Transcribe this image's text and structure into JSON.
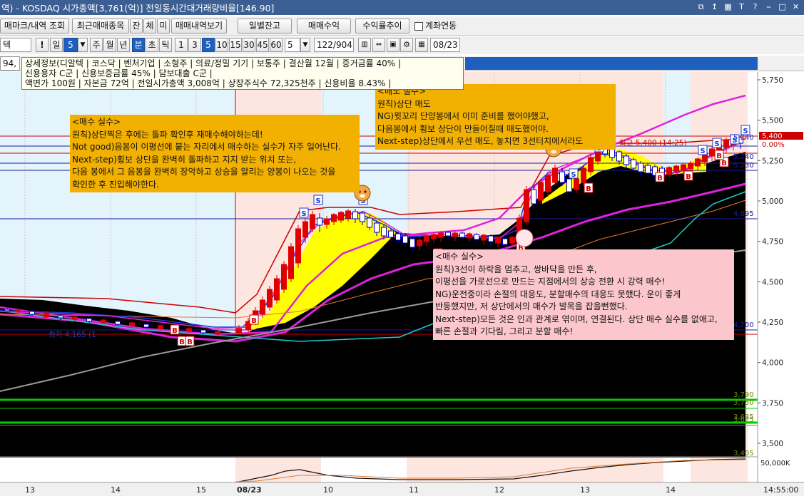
{
  "window": {
    "title": "역) - KOSDAQ 시가총액[3,761(억)] 전일동시간대거래량비율[146.90]",
    "buttons": [
      "⧉",
      "↥",
      "▦",
      "T",
      "?",
      "⎯",
      "□",
      "✕"
    ]
  },
  "row2": {
    "buttons": [
      "매마크/내역 조회",
      "최근매매종목",
      "잔",
      "체",
      "미",
      "매매내역보기",
      "일별잔고",
      "매매수익",
      "수익률추이"
    ],
    "checkbox_label": "계좌연동"
  },
  "toolbar": {
    "symbol_input": "텍",
    "excl": "!",
    "period_label": "일",
    "period_value": "5",
    "periods": [
      "주",
      "월",
      "년",
      "분",
      "초",
      "틱"
    ],
    "minutes": [
      "1",
      "3",
      "5",
      "10",
      "15",
      "30",
      "45",
      "60"
    ],
    "count_value": "5",
    "range": "122/904",
    "date": "08/23"
  },
  "row4": {
    "code": "94,"
  },
  "info": {
    "line1": "상세정보(디알텍 | 코스닥 | 벤처기업 | 소형주 | 의료/정밀 기기 | 보통주 | 결산월 12월 | 증거금률 40% |",
    "line2": "신용용자 C군 | 신용보증금률 45% | 담보대출 C군 |",
    "line3": "액면가 100원 | 자본금 72억 | 전일시가총액 3,008억 | 상장주식수 72,325천주 | 신용비율 8.43% |"
  },
  "notes": {
    "buy1": {
      "title": "<매수 실수>",
      "lines": [
        "원칙)상단찍은 후에는 돌파 확인후 재매수해야하는데!",
        "Not good)음봉이 이평선에 붙는 자리에서 매수하는 실수가 자주 일어난다.",
        "Next-step)횡보 상단을 완벽히 돌파하고 지지 받는 위치 또는,",
        "다음 봉에서 그 음봉을 완벽히 장악하고 상승을 알리는 양봉이 나오는 것을",
        "확인한 후 진입해야한다."
      ]
    },
    "sell": {
      "title": "<매도 실수>",
      "lines": [
        "원칙)상단 매도",
        "NG)윗꼬리 단양봉에서 이미 준비를 했어야했고,",
        "다음봉에서 횡보 상단이 만들어질때 매도했어야.",
        "Next-step)상단에서 우선 매도, 놓치면 3선터치에서라도"
      ]
    },
    "buy2": {
      "title": "<매수 실수>",
      "lines": [
        "원칙)3선이 하락을 멈추고, 쌍바닥을 만든 후,",
        "이평선을 가로선으로 만드는 지점에서의 상승 전환 시 강력 매수!",
        "NG)운전중이라 손절의 대응도, 분할매수의 대응도 못했다. 운이 좋게",
        "반등했지만, 저 상단에서의 매수가 발목을 잡을뻔했다.",
        "Next-step)모든 것은 인과 관계로 엮이며, 연결된다. 상단 매수 실수를 없애고,",
        "빠른 손절과 기다림, 그리고 분할 매수!"
      ]
    }
  },
  "chart_labels": {
    "high": "최고 5,400 (14:25)",
    "low": "최저 4,165 (1",
    "price_tag": "5,400",
    "pct_tag": "0.00%",
    "p5240": "5,240",
    "p5230": "5,230",
    "p4895": "4,895",
    "p4200": "4,200",
    "p3790": "3,790",
    "p3750": "3,750",
    "p3635": "3,635",
    "p3625": "3,625",
    "p3405": "3,405",
    "vol": "50,000K",
    "time": "14:55:00"
  },
  "y_ticks": [
    "5,750",
    "5,500",
    "5,250",
    "5,000",
    "4,750",
    "4,500",
    "4,250",
    "4,000",
    "3,750",
    "3,500"
  ],
  "x_ticks": [
    "13",
    "14",
    "15",
    "08/23",
    "10",
    "11",
    "12",
    "13",
    "14"
  ],
  "colors": {
    "title_bar": "#3b5f93",
    "selected": "#1f5fbd",
    "note_orange": "#f2b000",
    "note_pink": "#fbc7cc",
    "candle_up": "#e00000",
    "candle_down": "#0000cc",
    "cloud": "#ffff00",
    "band": "#dd22dd"
  },
  "icons": [
    "restore-icon",
    "pin-icon",
    "layout-icon",
    "font-icon",
    "help-icon",
    "minimize-icon",
    "maximize-icon",
    "close-icon"
  ]
}
